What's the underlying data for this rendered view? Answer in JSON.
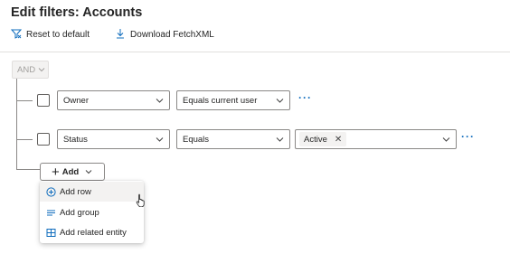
{
  "header": {
    "title": "Edit filters: Accounts"
  },
  "toolbar": {
    "reset_label": "Reset to default",
    "download_label": "Download FetchXML"
  },
  "group": {
    "operator": "AND"
  },
  "rows": [
    {
      "field": "Owner",
      "operator": "Equals current user",
      "value": ""
    },
    {
      "field": "Status",
      "operator": "Equals",
      "value_tag": "Active"
    }
  ],
  "add_button": {
    "label": "Add"
  },
  "add_menu": {
    "items": [
      {
        "label": "Add row",
        "icon": "add-circle-icon"
      },
      {
        "label": "Add group",
        "icon": "lines-icon"
      },
      {
        "label": "Add related entity",
        "icon": "related-entity-icon"
      }
    ]
  },
  "colors": {
    "accent": "#0f6cbd",
    "border": "#8a8886",
    "hover": "#f3f2f1"
  }
}
